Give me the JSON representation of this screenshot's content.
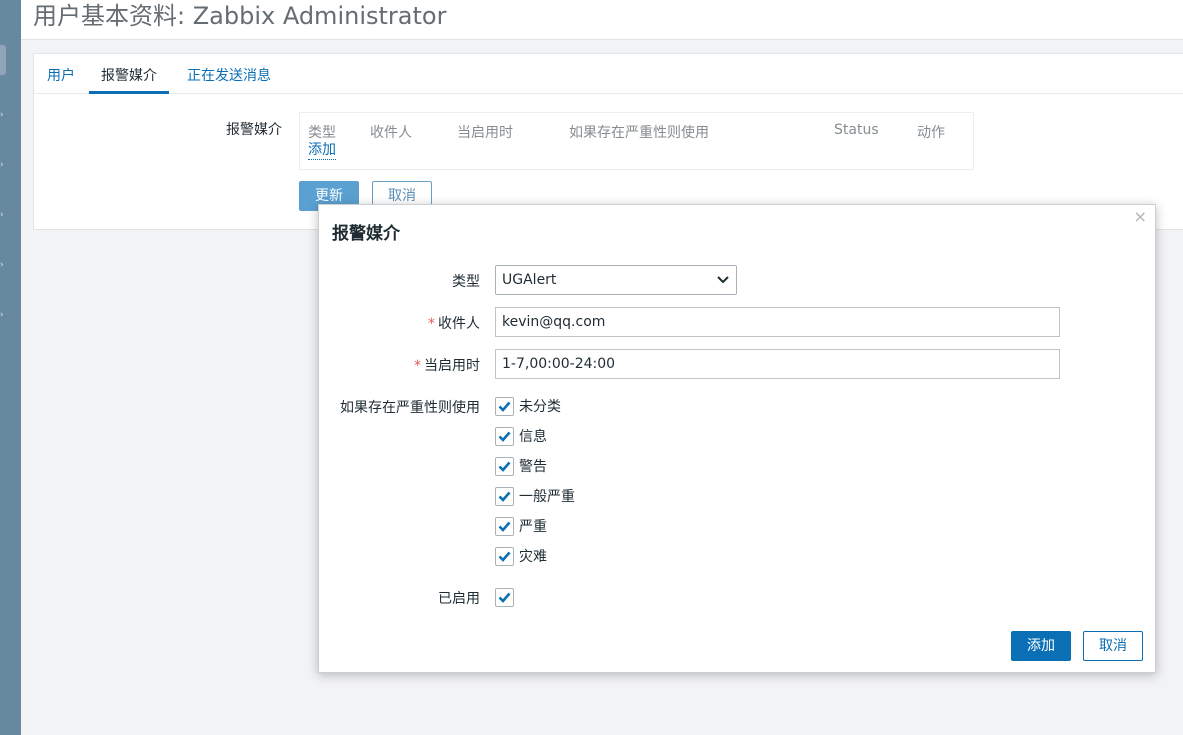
{
  "page": {
    "title": "用户基本资料: Zabbix Administrator"
  },
  "tabs": [
    {
      "label": "用户"
    },
    {
      "label": "报警媒介"
    },
    {
      "label": "正在发送消息"
    }
  ],
  "media_section": {
    "label": "报警媒介",
    "columns": [
      "类型",
      "收件人",
      "当启用时",
      "如果存在严重性则使用",
      "Status",
      "动作"
    ],
    "add_link": "添加"
  },
  "form_buttons": {
    "update": "更新",
    "cancel": "取消"
  },
  "dialog": {
    "title": "报警媒介",
    "close_symbol": "×",
    "type": {
      "label": "类型",
      "value": "UGAlert"
    },
    "recipient": {
      "required_mark": "*",
      "label": "收件人",
      "value": "kevin@qq.com"
    },
    "active_when": {
      "required_mark": "*",
      "label": "当启用时",
      "value": "1-7,00:00-24:00"
    },
    "severity": {
      "label": "如果存在严重性则使用",
      "options": [
        {
          "label": "未分类",
          "checked": true
        },
        {
          "label": "信息",
          "checked": true
        },
        {
          "label": "警告",
          "checked": true
        },
        {
          "label": "一般严重",
          "checked": true
        },
        {
          "label": "严重",
          "checked": true
        },
        {
          "label": "灾难",
          "checked": true
        }
      ]
    },
    "enabled": {
      "label": "已启用",
      "checked": true
    },
    "add_button": "添加",
    "cancel_button": "取消"
  },
  "colors": {
    "accent": "#0b6fb5",
    "sidebar": "#6789a0",
    "required": "#e45959",
    "background": "#f2f3f4"
  },
  "icons": {
    "checkbox": "checkmark-icon",
    "dropdown": "chevron-down-icon",
    "close": "close-icon"
  }
}
